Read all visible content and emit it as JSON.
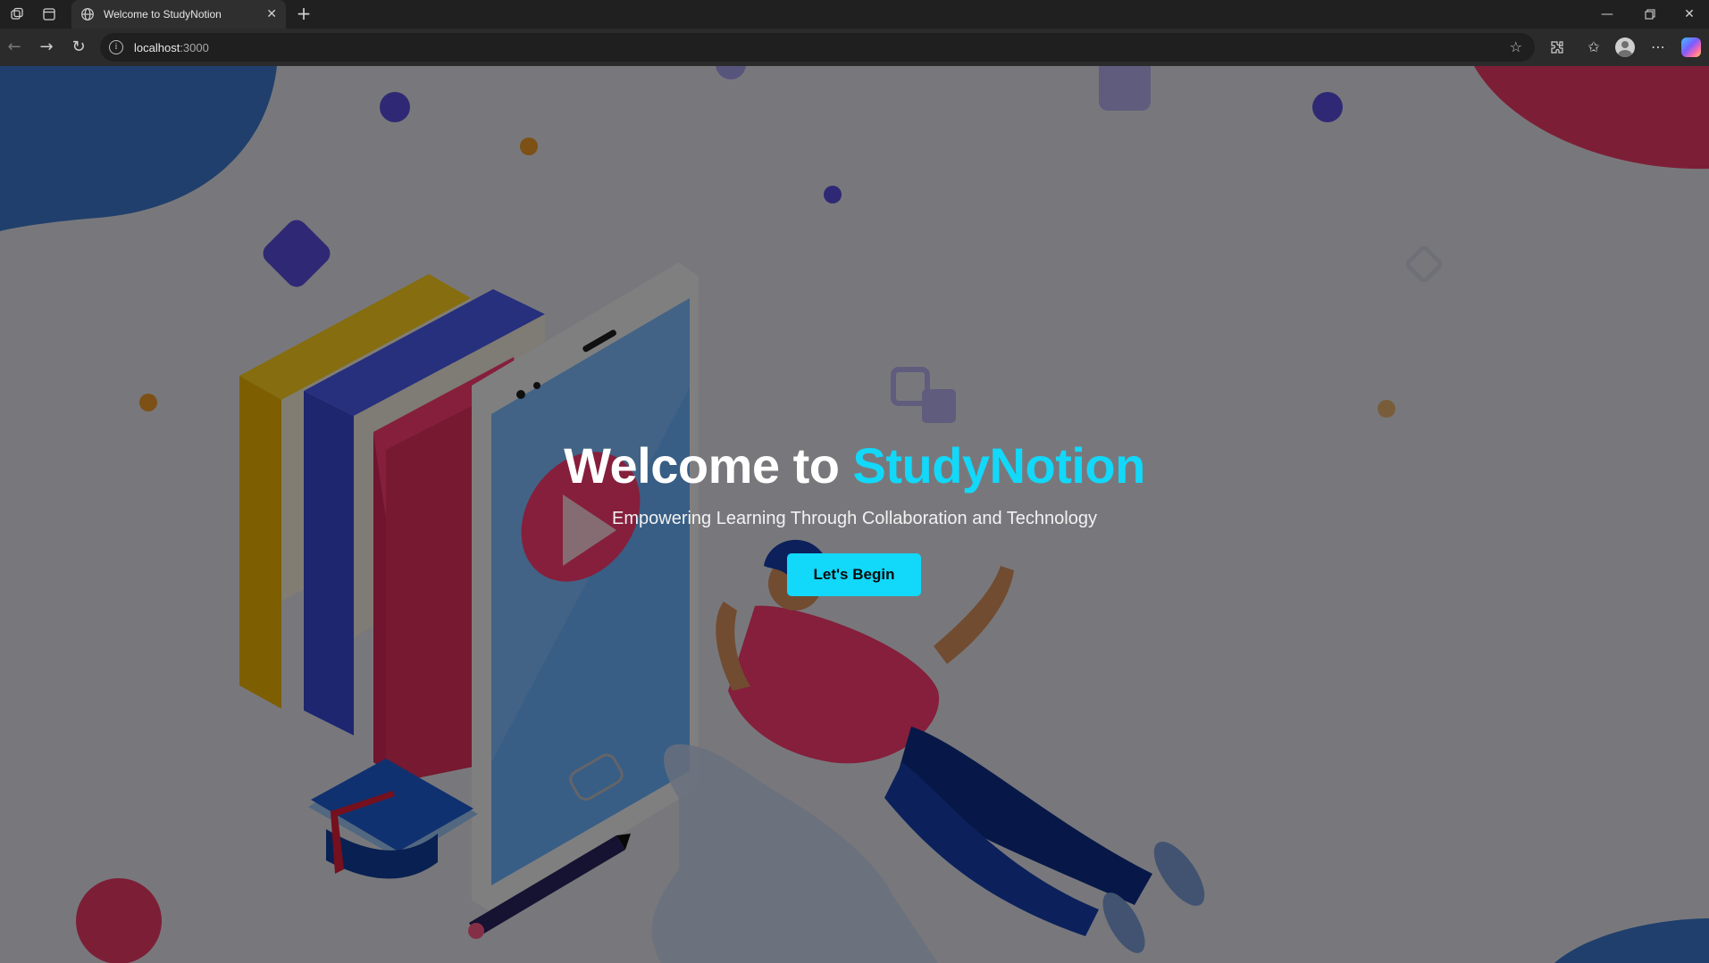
{
  "browser": {
    "tab_title": "Welcome to StudyNotion",
    "url_host": "localhost",
    "url_port": ":3000"
  },
  "hero": {
    "title_prefix": "Welcome to ",
    "title_brand": "StudyNotion",
    "subtitle": "Empowering Learning Through Collaboration and Technology",
    "cta_label": "Let's Begin"
  },
  "colors": {
    "brand_accent": "#12d8fa",
    "overlay": "rgba(0,0,0,0.48)"
  },
  "icons": [
    "workspaces-icon",
    "tab-actions-icon",
    "globe-icon",
    "close-icon",
    "plus-icon",
    "minimize-icon",
    "restore-icon",
    "back-icon",
    "forward-icon",
    "refresh-icon",
    "info-icon",
    "star-icon",
    "extensions-icon",
    "favorites-icon",
    "profile-icon",
    "more-icon",
    "copilot-icon"
  ]
}
